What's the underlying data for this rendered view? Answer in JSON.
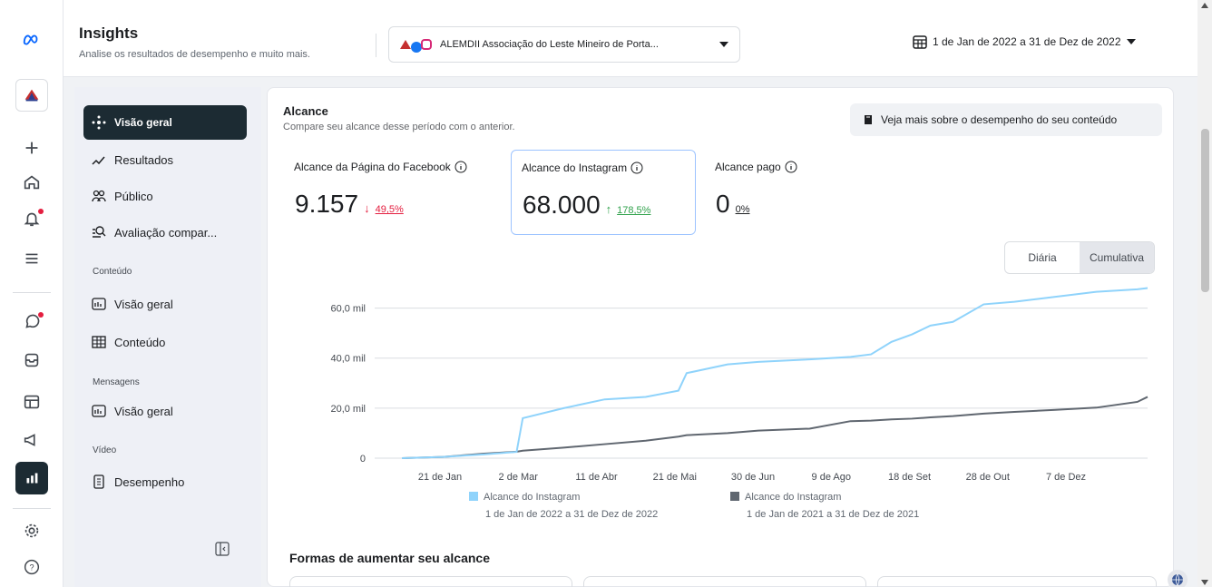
{
  "header": {
    "title": "Insights",
    "subtitle": "Analise os resultados de desempenho e muito mais.",
    "account_name": "ALEMDII Associação do Leste Mineiro de Porta...",
    "date_range": "1 de Jan de 2022 a 31 de Dez de 2022"
  },
  "rail": {
    "items": [
      "meta-logo",
      "page-avatar",
      "create",
      "home",
      "notifications",
      "menu",
      "content-bubble",
      "inbox",
      "planner",
      "ads",
      "insights",
      "settings",
      "help"
    ]
  },
  "sidebar": {
    "items": [
      {
        "label": "Visão geral",
        "icon": "overview-icon"
      },
      {
        "label": "Resultados",
        "icon": "results-icon"
      },
      {
        "label": "Público",
        "icon": "audience-icon"
      },
      {
        "label": "Avaliação compar...",
        "icon": "benchmark-icon"
      }
    ],
    "section_content": "Conteúdo",
    "content_items": [
      {
        "label": "Visão geral",
        "icon": "content-overview-icon"
      },
      {
        "label": "Conteúdo",
        "icon": "table-icon"
      }
    ],
    "section_messages": "Mensagens",
    "messages_items": [
      {
        "label": "Visão geral",
        "icon": "messages-overview-icon"
      }
    ],
    "section_video": "Vídeo",
    "video_items": [
      {
        "label": "Desempenho",
        "icon": "document-icon"
      }
    ]
  },
  "reach": {
    "title": "Alcance",
    "subtitle": "Compare seu alcance desse período com o anterior.",
    "more_button": "Veja mais sobre o desempenho do seu conteúdo",
    "metrics": [
      {
        "label": "Alcance da Página do Facebook",
        "value": "9.157",
        "delta": "49,5%",
        "direction": "down"
      },
      {
        "label": "Alcance do Instagram",
        "value": "68.000",
        "delta": "178,5%",
        "direction": "up"
      },
      {
        "label": "Alcance pago",
        "value": "0",
        "delta": "0%",
        "direction": "none"
      }
    ],
    "toggle": {
      "daily": "Diária",
      "cumulative": "Cumulativa",
      "selected": "Cumulativa"
    },
    "legend": [
      {
        "name": "Alcance do Instagram",
        "period": "1 de Jan de 2022 a 31 de Dez de 2022",
        "color": "#8fd3fb"
      },
      {
        "name": "Alcance do Instagram",
        "period": "1 de Jan de 2021 a 31 de Dez de 2021",
        "color": "#606770"
      }
    ],
    "ways_title": "Formas de aumentar seu alcance"
  },
  "chart_data": {
    "type": "line",
    "title": "",
    "xlabel": "",
    "ylabel": "",
    "ylim": [
      0,
      70000
    ],
    "x_tick_labels": [
      "21 de Jan",
      "2 de Mar",
      "11 de Abr",
      "21 de Mai",
      "30 de Jun",
      "9 de Ago",
      "18 de Set",
      "28 de Out",
      "7 de Dez"
    ],
    "y_tick_labels": [
      "0",
      "20,0 mil",
      "40,0 mil",
      "60,0 mil"
    ],
    "y_ticks": [
      0,
      20000,
      40000,
      60000
    ],
    "grid": true,
    "legend_position": "bottom",
    "x_days": [
      1,
      21,
      41,
      57,
      60,
      80,
      100,
      120,
      136,
      140,
      160,
      175,
      200,
      220,
      230,
      240,
      250,
      259,
      270,
      285,
      300,
      320,
      340,
      360,
      365
    ],
    "series": [
      {
        "name": "Alcance do Instagram",
        "color": "#8fd3fb",
        "values": [
          0,
          500,
          1500,
          2500,
          16000,
          20000,
          23500,
          24500,
          27000,
          34000,
          37500,
          38500,
          39500,
          40500,
          41500,
          46500,
          49500,
          53000,
          54500,
          61500,
          62500,
          64500,
          66500,
          67500,
          68000
        ]
      },
      {
        "name": "Alcance do Instagram",
        "color": "#606770",
        "values": [
          0,
          500,
          1800,
          2600,
          3000,
          4200,
          5600,
          7000,
          8600,
          9200,
          10000,
          11000,
          11800,
          14800,
          15000,
          15500,
          15800,
          16300,
          16800,
          17800,
          18500,
          19300,
          20200,
          22500,
          24500
        ]
      }
    ]
  }
}
